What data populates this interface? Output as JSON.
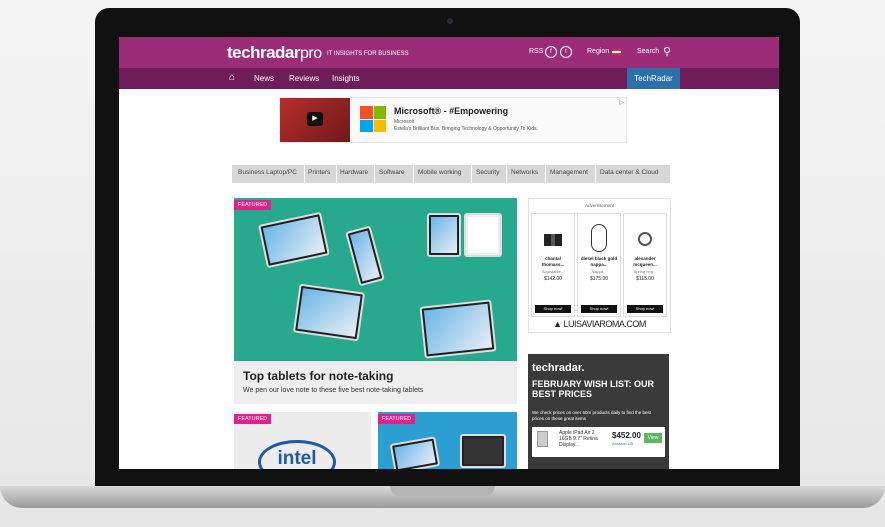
{
  "header": {
    "logo_main": "techradar",
    "logo_suffix": "pro",
    "tagline": "IT INSIGHTS FOR BUSINESS",
    "rss": "RSS",
    "region": "Region",
    "search": "Search"
  },
  "nav": {
    "items": [
      "News",
      "Reviews",
      "Insights"
    ],
    "site_tab": "TechRadar"
  },
  "top_ad": {
    "title": "Microsoft® - #Empowering",
    "brand": "Microsoft",
    "description": "Estela's Brilliant Bus. Bringing Technology & Opportunity To Kids."
  },
  "categories": [
    "Business Laptop/PC",
    "Printers",
    "Hardware",
    "Software",
    "Mobile working",
    "Security",
    "Networks",
    "Management",
    "Data center & Cloud"
  ],
  "featured": {
    "badge": "FEATURED",
    "title": "Top tablets for note-taking",
    "subtitle": "We pen our love note to these five best note-taking tablets"
  },
  "cards": [
    {
      "badge": "FEATURED",
      "logo": "intel"
    },
    {
      "badge": "FEATURED"
    }
  ],
  "side_ad": {
    "label": "Advertisement",
    "products": [
      {
        "name": "chantal",
        "name2": "thomass...",
        "desc": "Adjustable...",
        "price": "$142.00",
        "cta": "Shop now!"
      },
      {
        "name": "diesel black gold",
        "name2": "nappa...",
        "desc": "Nappa...",
        "price": "$175.00",
        "cta": "Shop now!"
      },
      {
        "name": "alexander",
        "name2": "mcqueen...",
        "desc": "Spring ring...",
        "price": "$115.00",
        "cta": "Shop now!"
      }
    ],
    "brand": "▲ LUISAVIAROMA.COM"
  },
  "promo": {
    "logo": "techradar.",
    "headline": "FEBRUARY WISH LIST: OUR BEST PRICES",
    "sub": "We check prices on over 60m products daily to find the best prices on these great items",
    "product": "Apple iPad Air 2 16GB 9.7\" Retina Display...",
    "price": "$452.00",
    "store": "Amazon US",
    "cta": "View"
  }
}
